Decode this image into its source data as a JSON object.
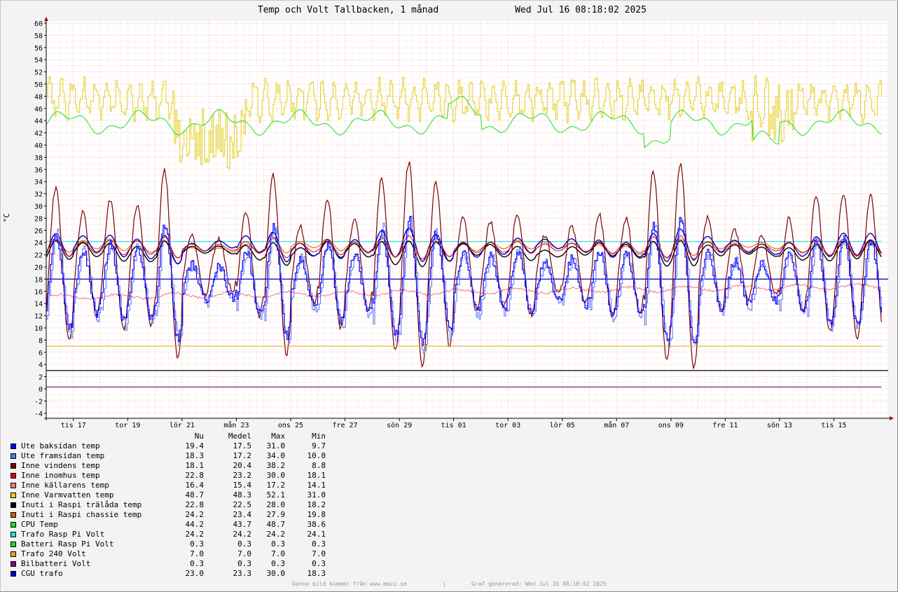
{
  "title": "Temp och Volt Tallbacken, 1 månad",
  "timestamp": "Wed Jul 16 08:18:02 2025",
  "footer": {
    "left": "Denna bild kommer från www.mmzz.se",
    "separator": "|",
    "right": "Graf genererad: Wed Jul 16 08:18:02 2025"
  },
  "chart_data": {
    "type": "line",
    "title": "Temp och Volt Tallbacken, 1 månad",
    "ylabel": "°C",
    "xlabel": "",
    "ylim": [
      -5,
      60
    ],
    "y_ticks": [
      -4,
      -2,
      0,
      2,
      4,
      6,
      8,
      10,
      12,
      14,
      16,
      18,
      20,
      22,
      24,
      26,
      28,
      30,
      32,
      34,
      36,
      38,
      40,
      42,
      44,
      46,
      48,
      50,
      52,
      54,
      56,
      58,
      60
    ],
    "x_range_days": [
      0,
      31
    ],
    "x_ticks": [
      {
        "day": 1,
        "label": "tis 17"
      },
      {
        "day": 3,
        "label": "tor 19"
      },
      {
        "day": 5,
        "label": "lör 21"
      },
      {
        "day": 7,
        "label": "mån 23"
      },
      {
        "day": 9,
        "label": "ons 25"
      },
      {
        "day": 11,
        "label": "fre 27"
      },
      {
        "day": 13,
        "label": "sön 29"
      },
      {
        "day": 15,
        "label": "tis 01"
      },
      {
        "day": 17,
        "label": "tor 03"
      },
      {
        "day": 19,
        "label": "lör 05"
      },
      {
        "day": 21,
        "label": "mån 07"
      },
      {
        "day": 23,
        "label": "ons 09"
      },
      {
        "day": 25,
        "label": "fre 11"
      },
      {
        "day": 27,
        "label": "sön 13"
      },
      {
        "day": 29,
        "label": "tis 15"
      }
    ],
    "grid": true,
    "legend_columns": [
      "Nu",
      "Medel",
      "Max",
      "Min"
    ],
    "series": [
      {
        "name": "Ute baksidan temp",
        "color": "#0000ff",
        "nu": "19.4",
        "medel": "17.5",
        "max": "31.0",
        "min": "9.7"
      },
      {
        "name": "Ute framsidan temp",
        "color": "#5b73f0",
        "nu": "18.3",
        "medel": "17.2",
        "max": "34.0",
        "min": "10.0"
      },
      {
        "name": "Inne vindens temp",
        "color": "#7a0000",
        "nu": "18.1",
        "medel": "20.4",
        "max": "38.2",
        "min": "8.8"
      },
      {
        "name": "Inne inomhus temp",
        "color": "#e00000",
        "nu": "22.8",
        "medel": "23.2",
        "max": "30.0",
        "min": "18.1"
      },
      {
        "name": "Inne källarens temp",
        "color": "#f27a7a",
        "nu": "16.4",
        "medel": "15.4",
        "max": "17.2",
        "min": "14.1"
      },
      {
        "name": "Inne Varmvatten temp",
        "color": "#e3cf1d",
        "nu": "48.7",
        "medel": "48.3",
        "max": "52.1",
        "min": "31.0"
      },
      {
        "name": "Inuti i Raspi trälåda temp",
        "color": "#000000",
        "nu": "22.8",
        "medel": "22.5",
        "max": "28.0",
        "min": "18.2"
      },
      {
        "name": "Inuti i Raspi chassie temp",
        "color": "#c86400",
        "nu": "24.2",
        "medel": "23.4",
        "max": "27.9",
        "min": "19.8"
      },
      {
        "name": "CPU Temp",
        "color": "#22dd22",
        "nu": "44.2",
        "medel": "43.7",
        "max": "48.7",
        "min": "38.6"
      },
      {
        "name": "Trafo Rasp Pi Volt",
        "color": "#22dddd",
        "nu": "24.2",
        "medel": "24.2",
        "max": "24.2",
        "min": "24.1"
      },
      {
        "name": "Batteri Rasp Pi Volt",
        "color": "#22dd22",
        "nu": "0.3",
        "medel": "0.3",
        "max": "0.3",
        "min": "0.3"
      },
      {
        "name": "Trafo 240 Volt",
        "color": "#f0a020",
        "nu": "7.0",
        "medel": "7.0",
        "max": "7.0",
        "min": "7.0"
      },
      {
        "name": "Bilbatteri Volt",
        "color": "#800080",
        "nu": "0.3",
        "medel": "0.3",
        "max": "0.3",
        "min": "0.3"
      },
      {
        "name": "CGU trafo",
        "color": "#0000cc",
        "nu": "23.0",
        "medel": "23.3",
        "max": "30.0",
        "min": "18.3"
      }
    ],
    "reference_lines": [
      {
        "y": 18,
        "color": "#0000cc"
      },
      {
        "y": 3,
        "color": "#000000"
      }
    ]
  }
}
